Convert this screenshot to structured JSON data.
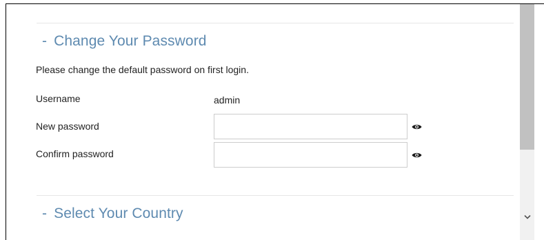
{
  "password_section": {
    "dash": "-",
    "title": "Change Your Password",
    "instruction": "Please change the default password on first login.",
    "username_label": "Username",
    "username_value": "admin",
    "new_password_label": "New password",
    "new_password_value": "",
    "confirm_password_label": "Confirm password",
    "confirm_password_value": ""
  },
  "country_section": {
    "dash": "-",
    "title": "Select Your Country"
  },
  "icons": {
    "show_password": "eye-icon",
    "scroll_down": "chevron-down-icon"
  },
  "colors": {
    "section_title": "#5e8ab0",
    "text": "#222222",
    "input_border": "#cccccc",
    "scroll_track": "#f1f1f1",
    "scroll_thumb": "#c1c1c1"
  }
}
